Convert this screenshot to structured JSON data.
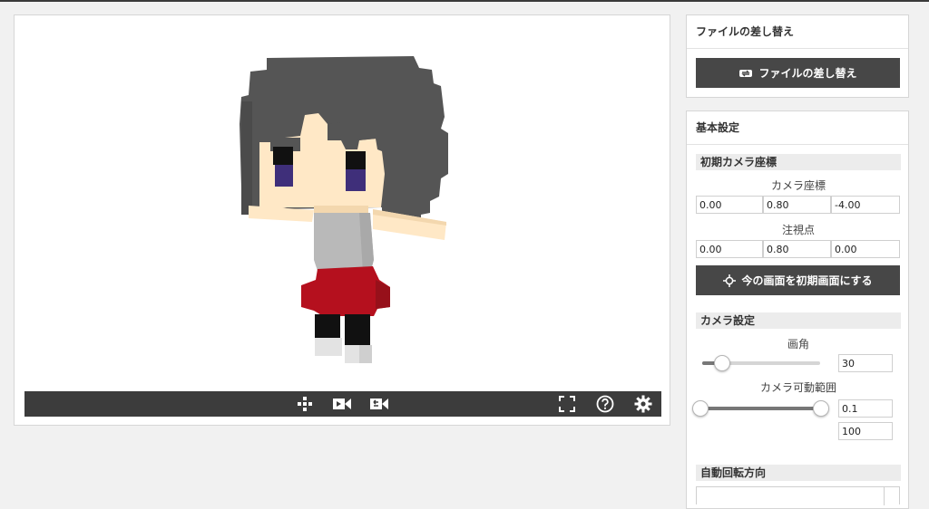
{
  "viewer": {
    "toolbar": {
      "icons": [
        "move-icon",
        "camera-record-icon",
        "camera-reset-icon",
        "fullscreen-icon",
        "help-icon",
        "settings-icon"
      ]
    }
  },
  "file_panel": {
    "title": "ファイルの差し替え",
    "button_label": "ファイルの差し替え"
  },
  "settings_panel": {
    "title": "基本設定",
    "initial_camera": {
      "heading": "初期カメラ座標",
      "camera_position_label": "カメラ座標",
      "camera_position": [
        "0.00",
        "0.80",
        "-4.00"
      ],
      "target_label": "注視点",
      "target": [
        "0.00",
        "0.80",
        "0.00"
      ],
      "set_button_label": "今の画面を初期画面にする"
    },
    "camera_settings": {
      "heading": "カメラ設定",
      "fov_label": "画角",
      "fov_value": "30",
      "range_label": "カメラ可動範囲",
      "range_min": "0.1",
      "range_max": "100"
    },
    "auto_rotate": {
      "heading": "自動回転方向"
    }
  },
  "colors": {
    "toolbar_bg": "#3c3c3c",
    "button_bg": "#474747",
    "hair": "#555555",
    "skin": "#ffe8c6",
    "shirt": "#b9b9b9",
    "skirt": "#b5101e",
    "eyes": "#3f2f7a"
  }
}
